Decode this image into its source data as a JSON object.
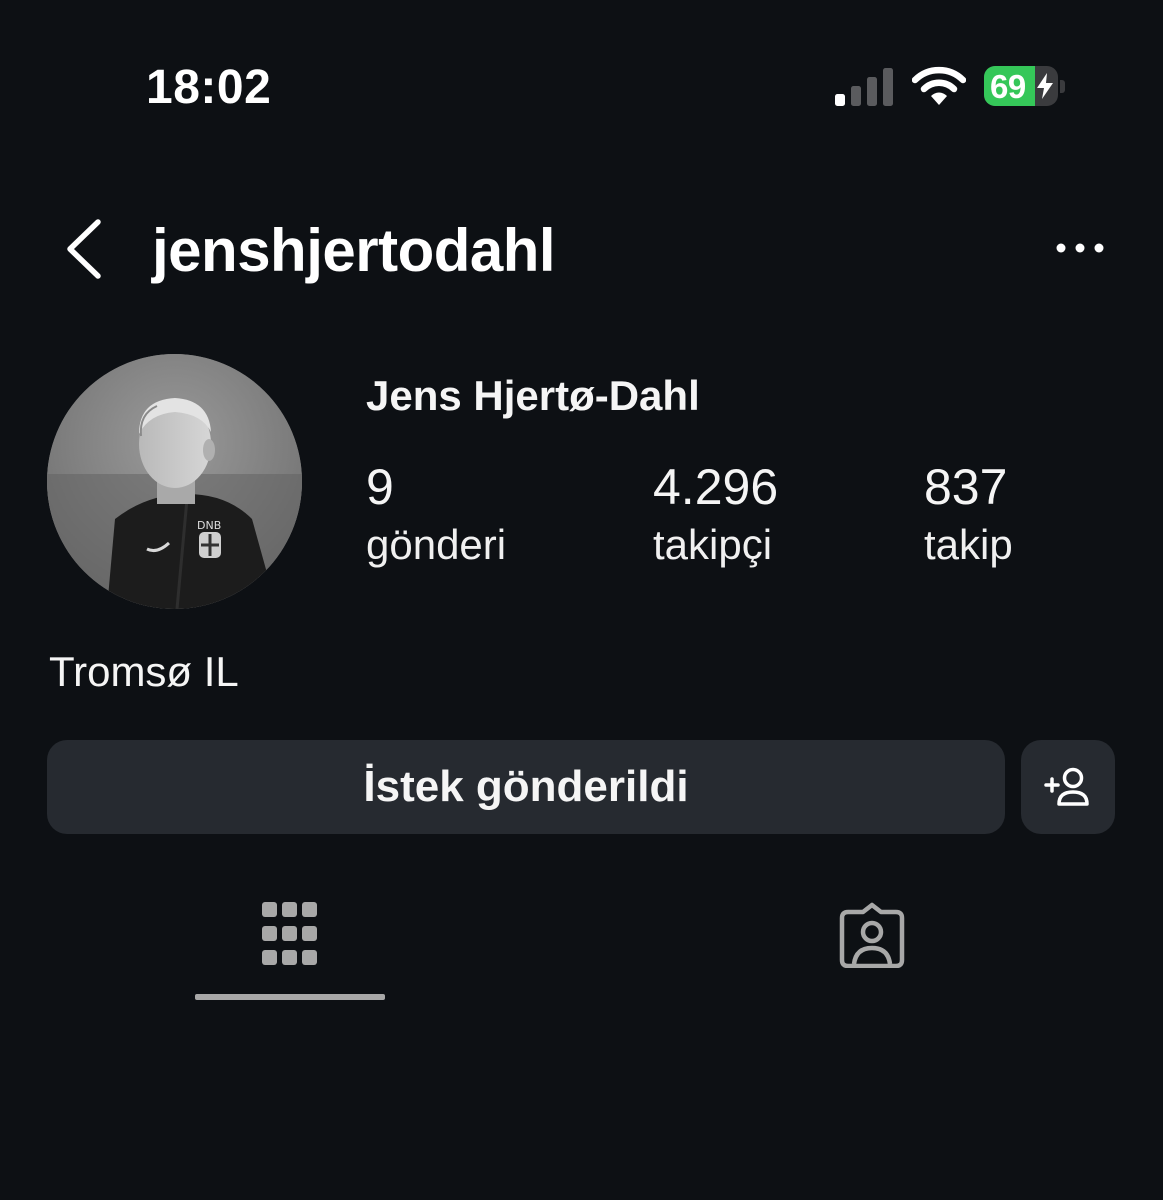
{
  "status_bar": {
    "time": "18:02",
    "battery_level": "69",
    "battery_fraction": 0.69,
    "battery_color": "#35c759",
    "signal_bars_active": 1,
    "icons": [
      "cellular-signal-icon",
      "wifi-icon",
      "battery-charging-icon"
    ]
  },
  "header": {
    "username": "jenshjertodahl",
    "back_icon": "chevron-left-icon",
    "more_icon": "more-horizontal-icon"
  },
  "profile": {
    "display_name": "Jens Hjertø-Dahl",
    "stats": [
      {
        "value": "9",
        "label": "gönderi"
      },
      {
        "value": "4.296",
        "label": "takipçi"
      },
      {
        "value": "837",
        "label": "takip"
      }
    ],
    "bio": "Tromsø IL"
  },
  "actions": {
    "request_label": "İstek gönderildi",
    "suggest_icon": "add-person-icon"
  },
  "tabs": {
    "items": [
      "grid-icon",
      "tagged-person-icon"
    ],
    "active_index": 0
  },
  "colors": {
    "background": "#0d1014",
    "button": "#262a30",
    "text": "#f5f5f5"
  }
}
